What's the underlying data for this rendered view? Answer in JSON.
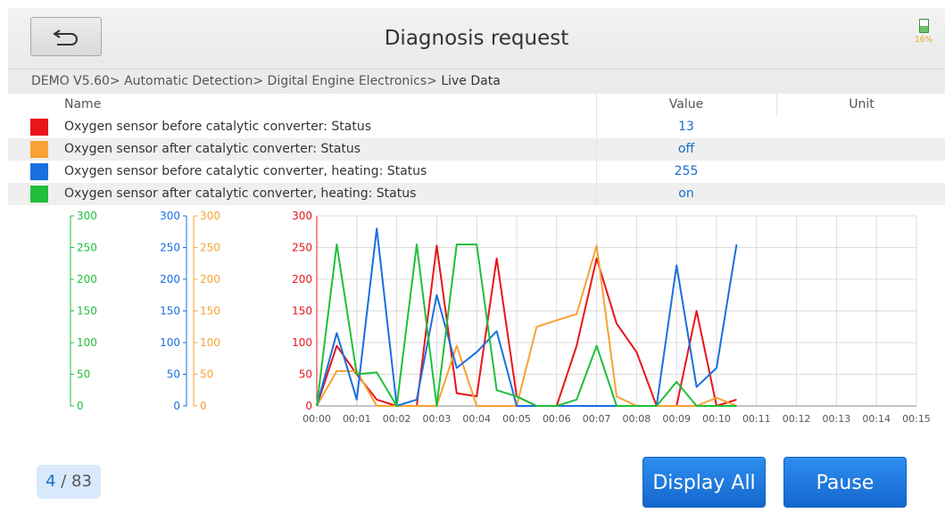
{
  "header": {
    "title": "Diagnosis request",
    "battery_text": "16%"
  },
  "breadcrumb": {
    "path": "DEMO V5.60> Automatic Detection> Digital Engine Electronics> ",
    "current": "Live Data"
  },
  "table": {
    "columns": {
      "name": "Name",
      "value": "Value",
      "unit": "Unit"
    },
    "rows": [
      {
        "name": "Oxygen sensor before catalytic converter: Status",
        "value": "13",
        "unit": "",
        "color": "#e8141a"
      },
      {
        "name": "Oxygen sensor after catalytic converter: Status",
        "value": "off",
        "unit": "",
        "color": "#f7a234"
      },
      {
        "name": "Oxygen sensor before catalytic converter, heating: Status",
        "value": "255",
        "unit": "",
        "color": "#1a6fe0"
      },
      {
        "name": "Oxygen sensor after catalytic converter, heating: Status",
        "value": "on",
        "unit": "",
        "color": "#1fbf3a"
      }
    ]
  },
  "chart_data": {
    "type": "line",
    "x": [
      "00:00",
      "00:01",
      "00:02",
      "00:03",
      "00:04",
      "00:05",
      "00:06",
      "00:07",
      "00:08",
      "00:09",
      "00:10",
      "00:11",
      "00:12",
      "00:13",
      "00:14",
      "00:15"
    ],
    "xlim": [
      0,
      15
    ],
    "ylim": [
      0,
      300
    ],
    "yticks": [
      "0",
      "50",
      "100",
      "150",
      "200",
      "250",
      "300"
    ],
    "grid": true,
    "series": [
      {
        "color": "#e8141a",
        "x": [
          0,
          0.5,
          1,
          1.5,
          2,
          2.5,
          3,
          3.5,
          4,
          4.5,
          5,
          5.5,
          6,
          6.5,
          7,
          7.5,
          8,
          8.5,
          9,
          9.5,
          10,
          10.5
        ],
        "y": [
          0,
          95,
          50,
          10,
          0,
          0,
          253,
          20,
          15,
          233,
          15,
          0,
          0,
          95,
          233,
          130,
          85,
          0,
          0,
          150,
          0,
          10
        ]
      },
      {
        "color": "#f7a234",
        "x": [
          0,
          0.5,
          1,
          1.5,
          2,
          2.5,
          3,
          3.5,
          4,
          4.5,
          5,
          5.5,
          6,
          6.5,
          7,
          7.5,
          8,
          8.5,
          9,
          9.5,
          10,
          10.5
        ],
        "y": [
          0,
          55,
          55,
          0,
          0,
          0,
          0,
          95,
          0,
          0,
          0,
          125,
          135,
          145,
          253,
          15,
          0,
          0,
          0,
          0,
          13,
          0
        ]
      },
      {
        "color": "#1a6fe0",
        "x": [
          0,
          0.5,
          1,
          1.5,
          2,
          2.5,
          3,
          3.5,
          4,
          4.5,
          5,
          5.5,
          6,
          6.5,
          7,
          7.5,
          8,
          8.5,
          9,
          9.5,
          10,
          10.5
        ],
        "y": [
          0,
          115,
          10,
          280,
          0,
          10,
          175,
          60,
          85,
          118,
          0,
          0,
          0,
          0,
          0,
          0,
          0,
          0,
          222,
          30,
          60,
          255
        ]
      },
      {
        "color": "#1fbf3a",
        "x": [
          0,
          0.5,
          1,
          1.5,
          2,
          2.5,
          3,
          3.5,
          4,
          4.5,
          5,
          5.5,
          6,
          6.5,
          7,
          7.5,
          8,
          8.5,
          9,
          9.5,
          10,
          10.5
        ],
        "y": [
          0,
          255,
          50,
          53,
          0,
          255,
          0,
          255,
          255,
          25,
          15,
          0,
          0,
          10,
          95,
          0,
          0,
          0,
          38,
          0,
          0,
          0
        ]
      }
    ],
    "side_axes": [
      {
        "color": "#1fbf3a",
        "ticks": [
          "0",
          "50",
          "100",
          "150",
          "200",
          "250",
          "300"
        ]
      },
      {
        "color": "#1a6fe0",
        "ticks": [
          "0",
          "50",
          "100",
          "150",
          "200",
          "250",
          "300"
        ]
      },
      {
        "color": "#f7a234",
        "ticks": [
          "0",
          "50",
          "100",
          "150",
          "200",
          "250",
          "300"
        ]
      }
    ]
  },
  "pager": {
    "current": "4",
    "separator": " / ",
    "total": "83"
  },
  "buttons": {
    "display_all": "Display All",
    "pause": "Pause"
  }
}
